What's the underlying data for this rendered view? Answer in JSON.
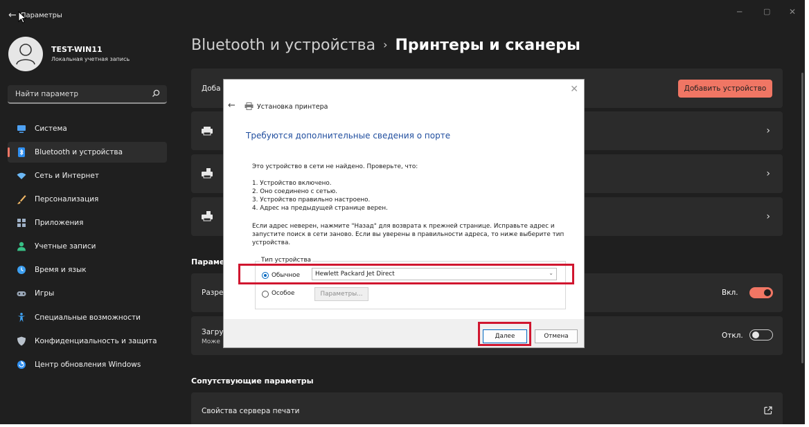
{
  "titlebar": {
    "title": "Параметры"
  },
  "account": {
    "name": "TEST-WIN11",
    "type": "Локальная учетная запись"
  },
  "search": {
    "placeholder": "Найти параметр"
  },
  "nav": [
    {
      "label": "Система",
      "icon": "monitor-icon",
      "color": "#4ea1f3"
    },
    {
      "label": "Bluetooth и устройства",
      "icon": "bluetooth-icon",
      "color": "#2f8ff0",
      "active": true
    },
    {
      "label": "Сеть и Интернет",
      "icon": "wifi-icon",
      "color": "#6cb8f5"
    },
    {
      "label": "Персонализация",
      "icon": "brush-icon",
      "color": "#f2b866"
    },
    {
      "label": "Приложения",
      "icon": "apps-icon",
      "color": "#9fb1c7"
    },
    {
      "label": "Учетные записи",
      "icon": "person-icon",
      "color": "#37c086"
    },
    {
      "label": "Время и язык",
      "icon": "globe-clock-icon",
      "color": "#3d9ff0"
    },
    {
      "label": "Игры",
      "icon": "gamepad-icon",
      "color": "#9aa7b8"
    },
    {
      "label": "Специальные возможности",
      "icon": "accessibility-icon",
      "color": "#3fa2f3"
    },
    {
      "label": "Конфиденциальность и защита",
      "icon": "shield-icon",
      "color": "#b9c2cc"
    },
    {
      "label": "Центр обновления Windows",
      "icon": "update-icon",
      "color": "#2f8ff0"
    }
  ],
  "breadcrumb": {
    "parent": "Bluetooth и устройства",
    "separator": "›",
    "current": "Принтеры и сканеры"
  },
  "page": {
    "add_row_label_partial": "Доба",
    "add_device_button": "Добавить устройство",
    "params_heading_partial": "Параме",
    "allow_row_partial": "Разре",
    "allow_toggle_label": "Вкл.",
    "download_row_partial": "Загру",
    "download_row_sub_partial": "Може",
    "download_toggle_label": "Откл.",
    "related_heading": "Сопутствующие параметры",
    "print_server_props": "Свойства сервера печати"
  },
  "dialog": {
    "title": "Установка принтера",
    "heading": "Требуются дополнительные сведения о порте",
    "intro": "Это устройство в сети не найдено. Проверьте, что:",
    "checklist": [
      "1.  Устройство включено.",
      "2.  Оно соединено с сетью.",
      "3.  Устройство правильно настроено.",
      "4.  Адрес на предыдущей странице верен."
    ],
    "advice": [
      "Если адрес неверен, нажмите \"Назад\" для возврата к прежней странице.  Исправьте адрес и",
      "запустите поиск в сети заново.  Если вы уверены в правильности адреса, то ниже выберите тип",
      "устройства."
    ],
    "device_type_legend": "Тип устройства",
    "radio_standard": "Обычное",
    "standard_value": "Hewlett Packard Jet Direct",
    "radio_custom": "Особое",
    "params_button": "Параметры...",
    "next_button": "Далее",
    "cancel_button": "Отмена"
  },
  "accent_color": "#f07664",
  "highlight_color": "#d0162f"
}
